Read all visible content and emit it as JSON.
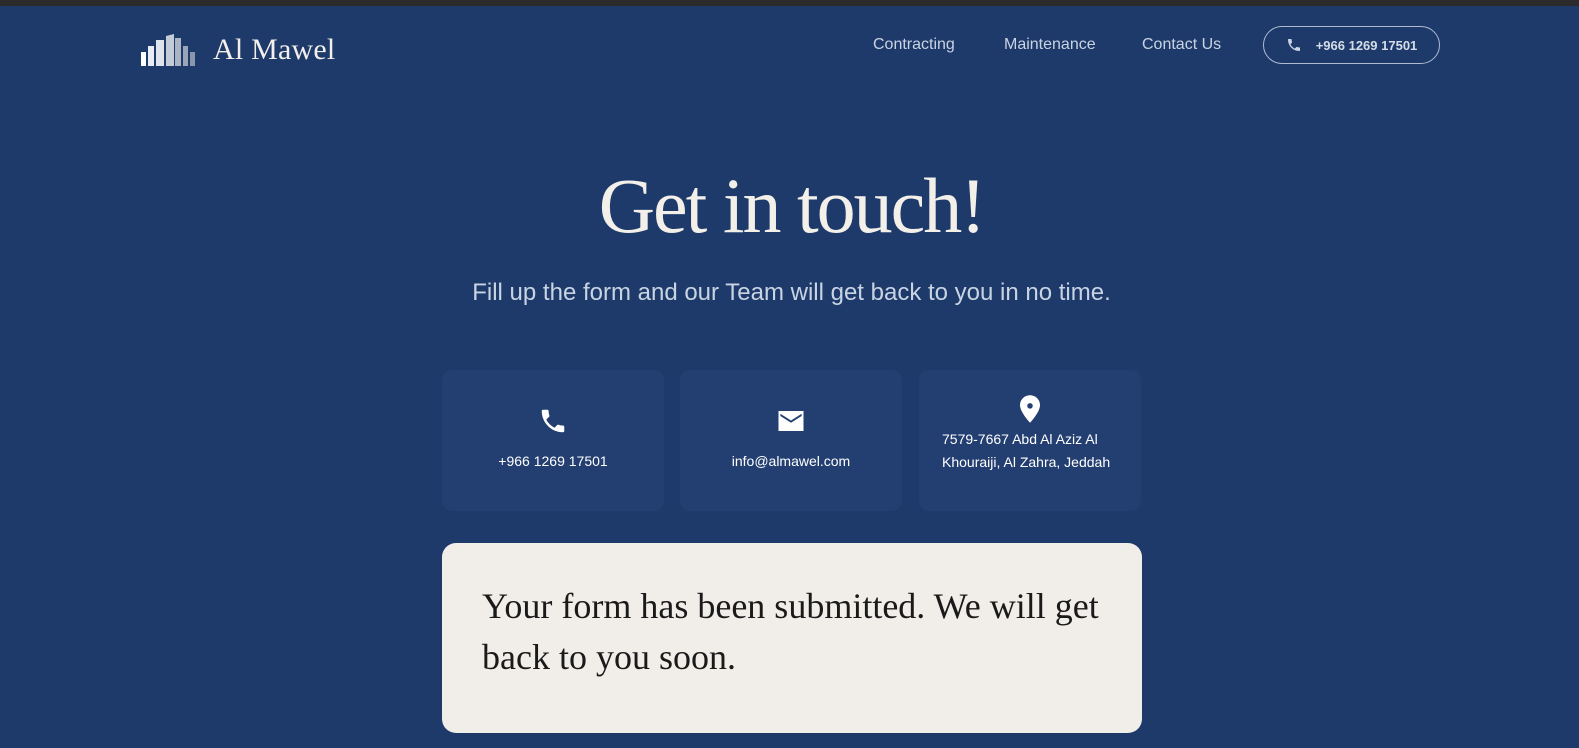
{
  "brand": {
    "name": "Al Mawel",
    "logo_icon": "buildings-logo"
  },
  "nav": {
    "items": [
      {
        "label": "Contracting"
      },
      {
        "label": "Maintenance"
      },
      {
        "label": "Contact Us"
      }
    ],
    "phone_button": {
      "label": "+966 1269 17501",
      "icon": "phone-icon"
    }
  },
  "hero": {
    "title": "Get in touch!",
    "subtitle": "Fill up the form and our Team will get back to you in no time."
  },
  "contact_cards": [
    {
      "icon": "phone-icon",
      "lines": [
        "+966 1269 17501"
      ]
    },
    {
      "icon": "mail-icon",
      "lines": [
        "info@almawel.com"
      ]
    },
    {
      "icon": "location-pin-icon",
      "lines": [
        "7579-7667 Abd Al Aziz Al",
        "Khouraiji, Al Zahra, Jeddah"
      ]
    }
  ],
  "form_status": {
    "message": "Your form has been submitted. We will get back to you soon."
  },
  "colors": {
    "background": "#1d3a6b",
    "card_background": "#233f71",
    "message_background": "#f1ede8",
    "heading_text": "#f3efe9"
  }
}
